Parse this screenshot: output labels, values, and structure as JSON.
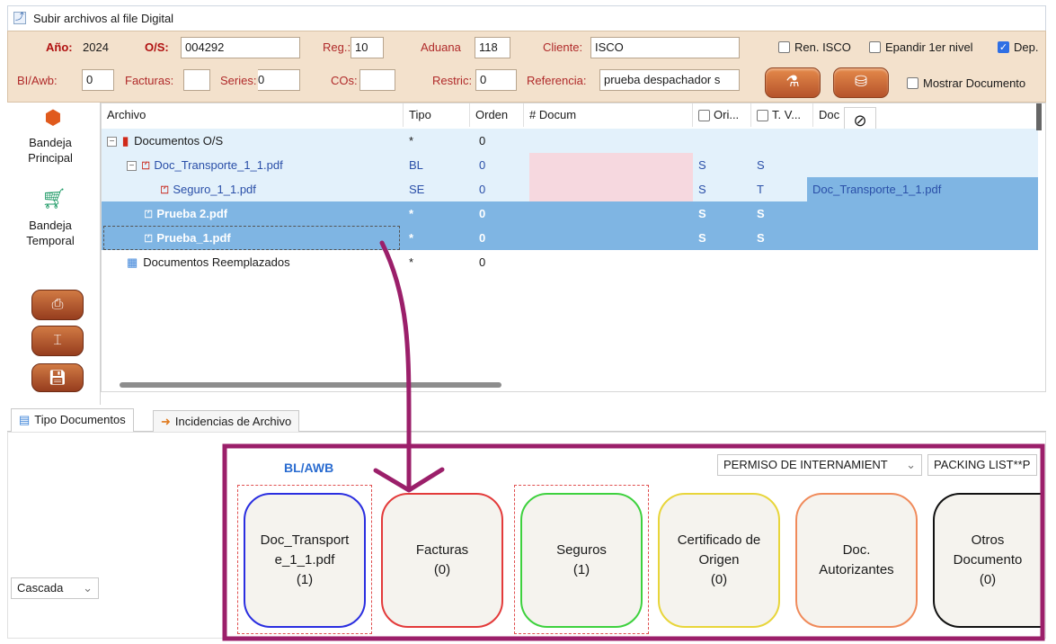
{
  "window": {
    "title": "Subir archivos al file Digital"
  },
  "header": {
    "anio_label": "Año:",
    "anio_value": "2024",
    "os_label": "O/S:",
    "os_value": "004292",
    "reg_label": "Reg.:",
    "reg_value": "10",
    "aduana_label": "Aduana",
    "aduana_value": "118",
    "cliente_label": "Cliente:",
    "cliente_value": "ISCO",
    "blawb_label": "BI/Awb:",
    "blawb_value": "0",
    "facturas_label": "Facturas:",
    "facturas_value": "",
    "series_label": "Series:",
    "series_value": "0",
    "cos_label": "COs:",
    "cos_value": "",
    "restric_label": "Restric:",
    "restric_value": "0",
    "referencia_label": "Referencia:",
    "referencia_value": "prueba despachador s",
    "chk_ren_isco": "Ren. ISCO",
    "chk_expandir": "Epandir 1er nivel",
    "chk_dep": "Dep.",
    "chk_mostrar": "Mostrar Documento"
  },
  "sidebar": {
    "bandeja_principal": "Bandeja Principal",
    "bandeja_temporal": "Bandeja Temporal"
  },
  "grid": {
    "columns": {
      "archivo": "Archivo",
      "tipo": "Tipo",
      "orden": "Orden",
      "documento": "# Docum",
      "original": "Ori...",
      "tv": "T. V...",
      "doc": "Doc"
    },
    "rows": [
      {
        "archivo": "Documentos O/S",
        "tipo": "*",
        "orden": "0",
        "ori": "",
        "tv": "",
        "doc": ""
      },
      {
        "archivo": "Doc_Transporte_1_1.pdf",
        "tipo": "BL",
        "orden": "0",
        "ori": "S",
        "tv": "S",
        "doc": ""
      },
      {
        "archivo": "Seguro_1_1.pdf",
        "tipo": "SE",
        "orden": "0",
        "ori": "S",
        "tv": "T",
        "doc": "Doc_Transporte_1_1.pdf"
      },
      {
        "archivo": "Prueba 2.pdf",
        "tipo": "*",
        "orden": "0",
        "ori": "S",
        "tv": "S",
        "doc": ""
      },
      {
        "archivo": "Prueba_1.pdf",
        "tipo": "*",
        "orden": "0",
        "ori": "S",
        "tv": "S",
        "doc": ""
      },
      {
        "archivo": "Documentos Reemplazados",
        "tipo": "*",
        "orden": "0",
        "ori": "",
        "tv": "",
        "doc": ""
      }
    ]
  },
  "tabs": {
    "tipo_documentos": "Tipo Documentos",
    "incidencias": "Incidencias de Archivo"
  },
  "bottom": {
    "layout_select": "Cascada",
    "bl_awb_label": "BL/AWB",
    "dropdown_1": "PERMISO DE INTERNAMIENT",
    "dropdown_2": "PACKING LIST**P",
    "cards": [
      {
        "l1": "Doc_Transport",
        "l2": "e_1_1.pdf",
        "l3": "(1)",
        "color": "#2a2ee0"
      },
      {
        "l1": "Facturas",
        "l2": "(0)",
        "l3": "",
        "color": "#e33a3a"
      },
      {
        "l1": "Seguros",
        "l2": "(1)",
        "l3": "",
        "color": "#3ed13e"
      },
      {
        "l1": "Certificado de",
        "l2": "Origen",
        "l3": "(0)",
        "color": "#e8d53a"
      },
      {
        "l1": "Doc.",
        "l2": "Autorizantes",
        "l3": "",
        "color": "#f08a5a"
      },
      {
        "l1": "Otros",
        "l2": "Documento",
        "l3": "(0)",
        "color": "#111111"
      }
    ]
  },
  "colors": {
    "annotation": "#9b1f6a",
    "selection": "#7fb5e3",
    "header_bg": "#f3e1cc"
  }
}
